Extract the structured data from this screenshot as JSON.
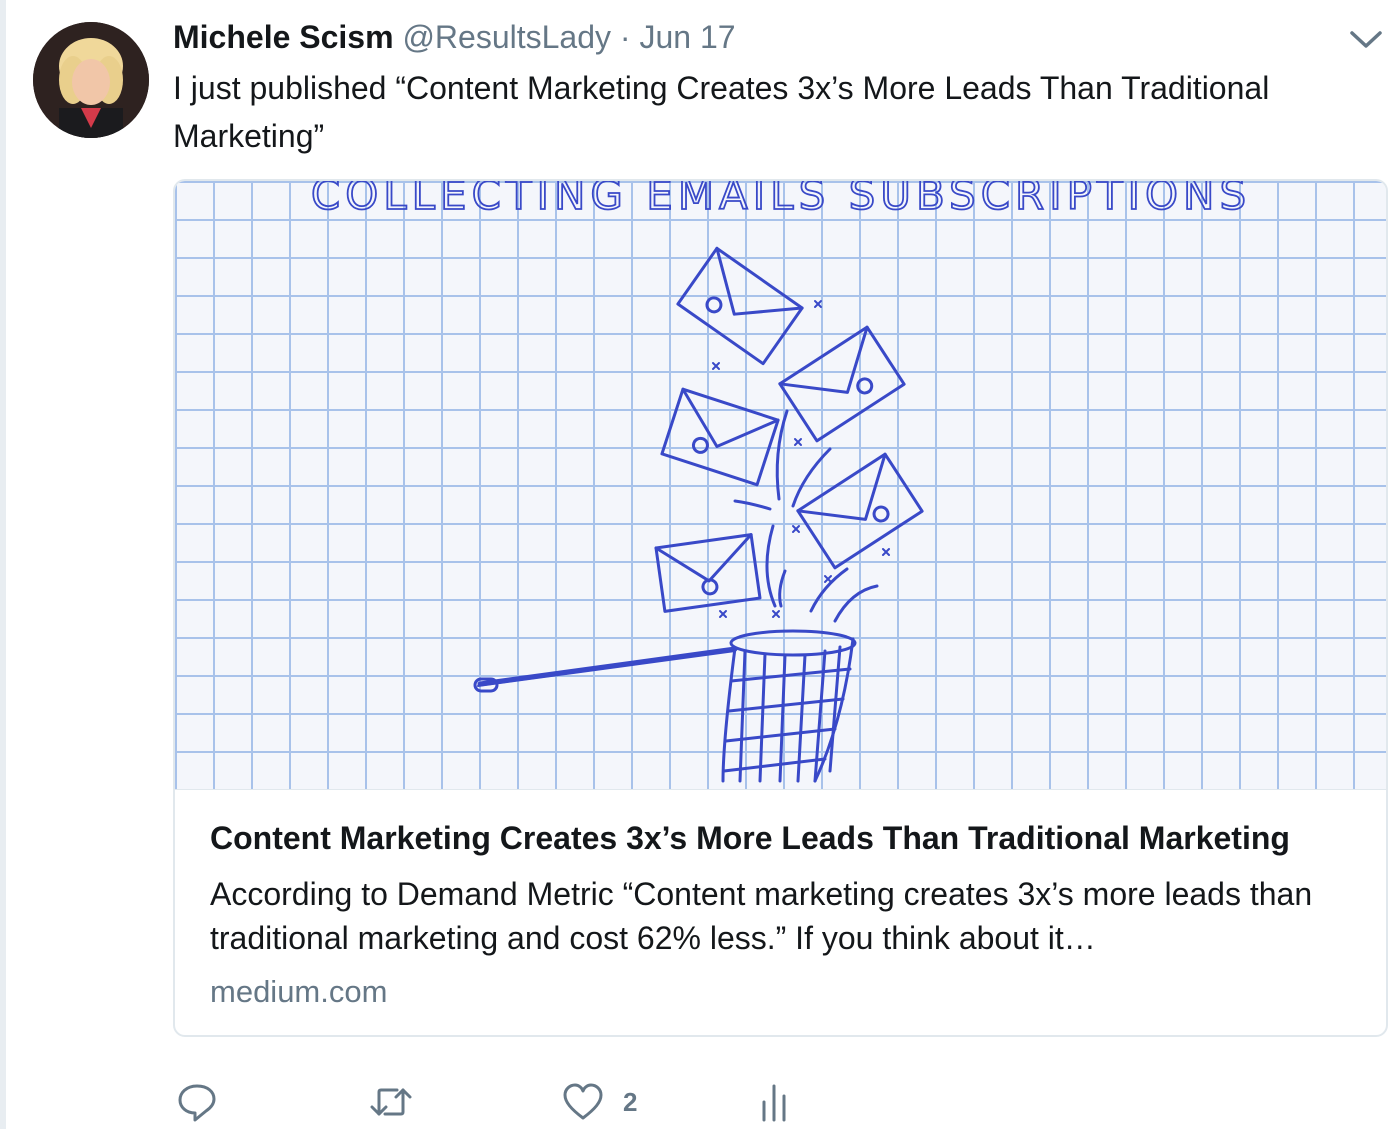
{
  "tweet": {
    "author_name": "Michele Scism",
    "handle": "@ResultsLady",
    "separator": "·",
    "date": "Jun 17",
    "text": "I just published “Content Marketing Creates 3x’s More Leads Than Traditional Marketing”"
  },
  "card": {
    "image_text": "COLLECTING EMAILS SUBSCRIPTIONS",
    "title": "Content Marketing Creates 3x’s More Leads Than Traditional Marketing",
    "description": "According to Demand Metric “Content marketing creates 3x’s more leads than traditional marketing and cost 62% less.” If you think about it…",
    "domain": "medium.com"
  },
  "actions": {
    "reply_icon": "reply-icon",
    "retweet_icon": "retweet-icon",
    "like_icon": "heart-icon",
    "like_count": "2",
    "analytics_icon": "analytics-icon"
  },
  "colors": {
    "text_primary": "#14171a",
    "text_secondary": "#657786",
    "card_border": "#e1e8ed",
    "sketch_ink": "#3949c8",
    "grid_line": "#a8c2ea"
  }
}
